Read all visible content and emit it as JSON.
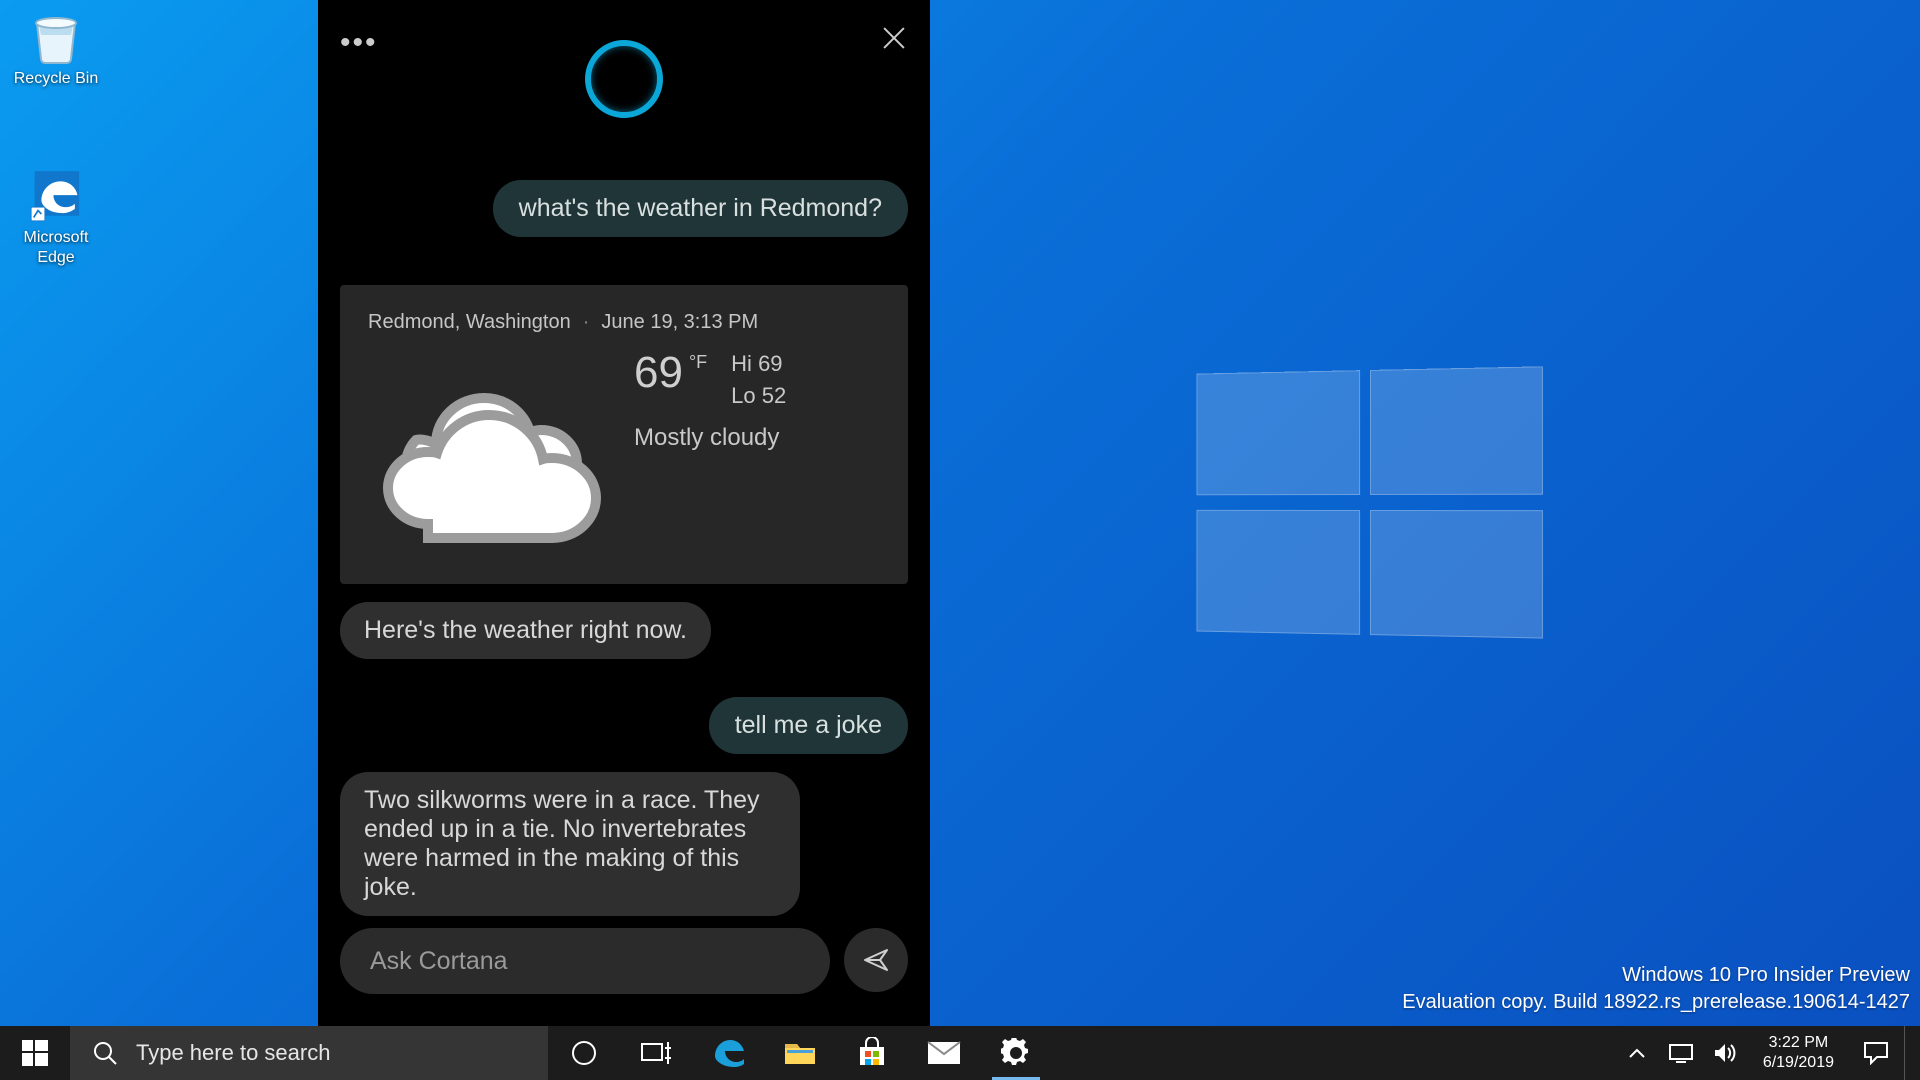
{
  "desktop": {
    "recycle_bin": "Recycle Bin",
    "edge": "Microsoft Edge"
  },
  "cortana": {
    "user_msg_1": "what's the weather in Redmond?",
    "weather": {
      "location": "Redmond, Washington",
      "timestamp": "June 19, 3:13 PM",
      "temp": "69",
      "unit": "°F",
      "hi_label": "Hi",
      "hi": "69",
      "lo_label": "Lo",
      "lo": "52",
      "condition": "Mostly cloudy"
    },
    "assistant_msg_1": "Here's the weather right now.",
    "user_msg_2": "tell me a joke",
    "assistant_msg_2": "Two silkworms were in a race. They ended up in a tie. No invertebrates were harmed in the making of this joke.",
    "input_placeholder": "Ask Cortana"
  },
  "watermark": {
    "line1": "Windows 10 Pro Insider Preview",
    "line2": "Evaluation copy. Build 18922.rs_prerelease.190614-1427"
  },
  "taskbar": {
    "search_placeholder": "Type here to search",
    "time": "3:22 PM",
    "date": "6/19/2019"
  }
}
